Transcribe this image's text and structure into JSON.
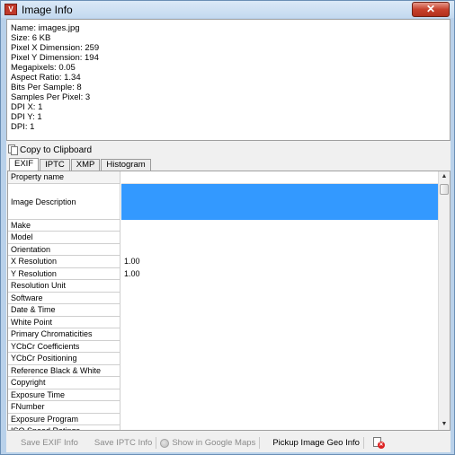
{
  "window": {
    "title": "Image Info",
    "app_icon_text": "V",
    "close_glyph": "✕"
  },
  "info": {
    "lines": [
      "Name: images.jpg",
      "Size: 6 KB",
      "Pixel X Dimension: 259",
      "Pixel Y Dimension: 194",
      "Megapixels: 0.05",
      "Aspect Ratio: 1.34",
      "Bits Per Sample: 8",
      "Samples Per Pixel: 3",
      "DPI X: 1",
      "DPI Y: 1",
      "DPI: 1"
    ]
  },
  "copy_to_clipboard_label": "Copy to Clipboard",
  "tabs": [
    {
      "label": "EXIF",
      "active": true
    },
    {
      "label": "IPTC",
      "active": false
    },
    {
      "label": "XMP",
      "active": false
    },
    {
      "label": "Histogram",
      "active": false
    }
  ],
  "grid": {
    "header": "Property name",
    "rows": [
      {
        "name": "Image Description",
        "value": "",
        "selected": true
      },
      {
        "name": "Make",
        "value": ""
      },
      {
        "name": "Model",
        "value": ""
      },
      {
        "name": "Orientation",
        "value": ""
      },
      {
        "name": "X Resolution",
        "value": "1.00"
      },
      {
        "name": "Y Resolution",
        "value": "1.00"
      },
      {
        "name": "Resolution Unit",
        "value": ""
      },
      {
        "name": "Software",
        "value": ""
      },
      {
        "name": "Date & Time",
        "value": ""
      },
      {
        "name": "White Point",
        "value": ""
      },
      {
        "name": "Primary Chromaticities",
        "value": ""
      },
      {
        "name": "YCbCr Coefficients",
        "value": ""
      },
      {
        "name": "YCbCr Positioning",
        "value": ""
      },
      {
        "name": "Reference Black & White",
        "value": ""
      },
      {
        "name": "Copyright",
        "value": ""
      },
      {
        "name": "Exposure Time",
        "value": ""
      },
      {
        "name": "FNumber",
        "value": ""
      },
      {
        "name": "Exposure Program",
        "value": ""
      },
      {
        "name": "ISO Speed Ratings",
        "value": ""
      }
    ]
  },
  "bottom": {
    "save_exif": "Save EXIF Info",
    "save_iptc": "Save IPTC Info",
    "show_maps": "Show in Google Maps",
    "pickup_geo": "Pickup Image Geo Info"
  },
  "colors": {
    "selection": "#3399ff",
    "window_frame": "#b9d1ea"
  }
}
